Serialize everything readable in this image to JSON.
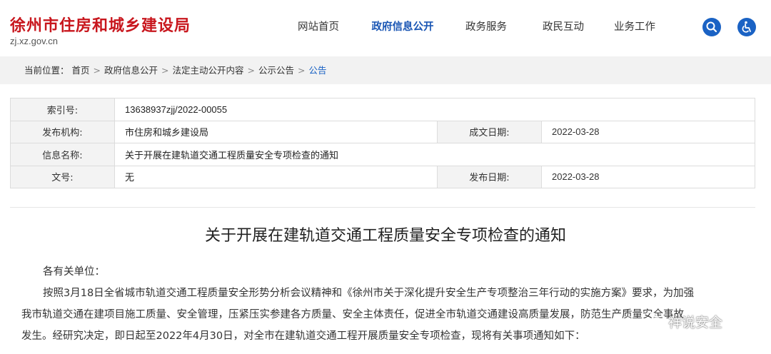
{
  "header": {
    "site_title": "徐州市住房和城乡建设局",
    "site_domain": "zj.xz.gov.cn",
    "nav": [
      "网站首页",
      "政府信息公开",
      "政务服务",
      "政民互动",
      "业务工作"
    ],
    "active_nav": "政府信息公开",
    "accent_color": "#1a62c4",
    "brand_color": "#c8161d"
  },
  "breadcrumb": {
    "prefix": "当前位置：",
    "items": [
      "首页",
      "政府信息公开",
      "法定主动公开内容",
      "公示公告",
      "公告"
    ],
    "separator": ">"
  },
  "info": {
    "index_label": "索引号:",
    "index_value": "13638937zjj/2022-00055",
    "publisher_label": "发布机构:",
    "publisher_value": "市住房和城乡建设局",
    "written_date_label": "成文日期:",
    "written_date_value": "2022-03-28",
    "name_label": "信息名称:",
    "name_value": "关于开展在建轨道交通工程质量安全专项检查的通知",
    "doc_no_label": "文号:",
    "doc_no_value": "无",
    "publish_date_label": "发布日期:",
    "publish_date_value": "2022-03-28"
  },
  "article": {
    "title": "关于开展在建轨道交通工程质量安全专项检查的通知",
    "salutation": "各有关单位：",
    "lines": [
      "按照3月18日全省城市轨道交通工程质量安全形势分析会议精神和《徐州市关于深化提升安全生产专项整治三年行动的实施方案》要求，为加强",
      "我市轨道交通在建项目施工质量、安全管理，压紧压实参建各方质量、安全主体责任，促进全市轨道交通建设高质量发展，防范生产质量安全事故",
      "发生。经研究决定，即日起至2022年4月30日，对全市在建轨道交通工程开展质量安全专项检查，现将有关事项通知如下："
    ]
  },
  "watermark": {
    "text": "祥说安全",
    "icon": "wechat-icon"
  }
}
